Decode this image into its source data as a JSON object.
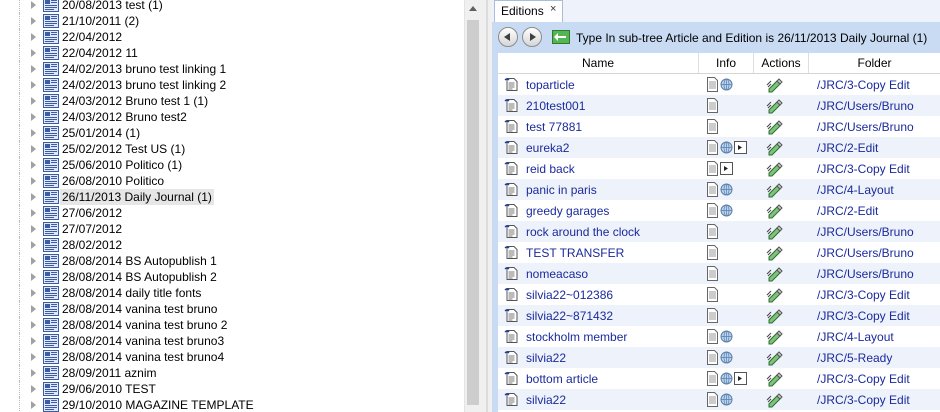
{
  "tree": {
    "items": [
      {
        "label": "20/08/2013 test (1)",
        "selected": false
      },
      {
        "label": "21/10/2011 (2)",
        "selected": false
      },
      {
        "label": "22/04/2012",
        "selected": false
      },
      {
        "label": "22/04/2012 11",
        "selected": false
      },
      {
        "label": "24/02/2013 bruno test linking 1",
        "selected": false
      },
      {
        "label": "24/02/2013 bruno test linking 2",
        "selected": false
      },
      {
        "label": "24/03/2012 Bruno test 1 (1)",
        "selected": false
      },
      {
        "label": "24/03/2012 Bruno test2",
        "selected": false
      },
      {
        "label": "25/01/2014 (1)",
        "selected": false
      },
      {
        "label": "25/02/2012 Test US (1)",
        "selected": false
      },
      {
        "label": "25/06/2010 Politico (1)",
        "selected": false
      },
      {
        "label": "26/08/2010 Politico",
        "selected": false
      },
      {
        "label": "26/11/2013 Daily Journal (1)",
        "selected": true
      },
      {
        "label": "27/06/2012",
        "selected": false
      },
      {
        "label": "27/07/2012",
        "selected": false
      },
      {
        "label": "28/02/2012",
        "selected": false
      },
      {
        "label": "28/08/2014 BS Autopublish 1",
        "selected": false
      },
      {
        "label": "28/08/2014 BS Autopublish 2",
        "selected": false
      },
      {
        "label": "28/08/2014 daily title fonts",
        "selected": false
      },
      {
        "label": "28/08/2014 vanina test bruno",
        "selected": false
      },
      {
        "label": "28/08/2014 vanina test bruno 2",
        "selected": false
      },
      {
        "label": "28/08/2014 vanina test bruno3",
        "selected": false
      },
      {
        "label": "28/08/2014 vanina test bruno4",
        "selected": false
      },
      {
        "label": "28/09/2011 aznim",
        "selected": false
      },
      {
        "label": "29/06/2010 TEST",
        "selected": false
      },
      {
        "label": "29/10/2010 MAGAZINE TEMPLATE",
        "selected": false
      }
    ]
  },
  "tab": {
    "label": "Editions",
    "close": "×"
  },
  "breadcrumb": "Type In sub-tree Article and Edition is 26/11/2013 Daily Journal (1)",
  "grid": {
    "columns": {
      "name": "Name",
      "info": "Info",
      "actions": "Actions",
      "folder": "Folder"
    },
    "rows": [
      {
        "name": "toparticle",
        "info": [
          "doc-icon",
          "globe-icon"
        ],
        "folder": "/JRC/3-Copy Edit"
      },
      {
        "name": "210test001",
        "info": [
          "doc-icon"
        ],
        "folder": "/JRC/Users/Bruno"
      },
      {
        "name": "test 77881",
        "info": [
          "doc-icon"
        ],
        "folder": "/JRC/Users/Bruno"
      },
      {
        "name": "eureka2",
        "info": [
          "doc-icon",
          "globe-icon",
          "export-icon"
        ],
        "folder": "/JRC/2-Edit"
      },
      {
        "name": "reid back",
        "info": [
          "doc-icon",
          "export-icon"
        ],
        "folder": "/JRC/3-Copy Edit"
      },
      {
        "name": "panic in paris",
        "info": [
          "doc-icon",
          "globe-icon"
        ],
        "folder": "/JRC/4-Layout"
      },
      {
        "name": "greedy garages",
        "info": [
          "doc-icon",
          "globe-icon"
        ],
        "folder": "/JRC/2-Edit"
      },
      {
        "name": "rock around the clock",
        "info": [
          "doc-icon"
        ],
        "folder": "/JRC/Users/Bruno"
      },
      {
        "name": "TEST TRANSFER",
        "info": [
          "doc-icon"
        ],
        "folder": "/JRC/Users/Bruno"
      },
      {
        "name": "nomeacaso",
        "info": [
          "doc-icon"
        ],
        "folder": "/JRC/Users/Bruno"
      },
      {
        "name": "silvia22~012386",
        "info": [
          "doc-icon"
        ],
        "folder": "/JRC/3-Copy Edit"
      },
      {
        "name": "silvia22~871432",
        "info": [
          "doc-icon"
        ],
        "folder": "/JRC/3-Copy Edit"
      },
      {
        "name": "stockholm member",
        "info": [
          "doc-icon",
          "globe-icon"
        ],
        "folder": "/JRC/4-Layout"
      },
      {
        "name": "silvia22",
        "info": [
          "doc-icon",
          "globe-icon"
        ],
        "folder": "/JRC/5-Ready"
      },
      {
        "name": "bottom article",
        "info": [
          "doc-icon",
          "globe-icon",
          "export-icon"
        ],
        "folder": "/JRC/3-Copy Edit"
      },
      {
        "name": "silvia22",
        "info": [
          "doc-icon",
          "globe-icon"
        ],
        "folder": "/JRC/3-Copy Edit"
      }
    ]
  },
  "colors": {
    "link": "#1a2a9c",
    "pane_bg": "#c9daf3",
    "row_alt": "#eef2fb",
    "selected": "#e6e6e6"
  }
}
